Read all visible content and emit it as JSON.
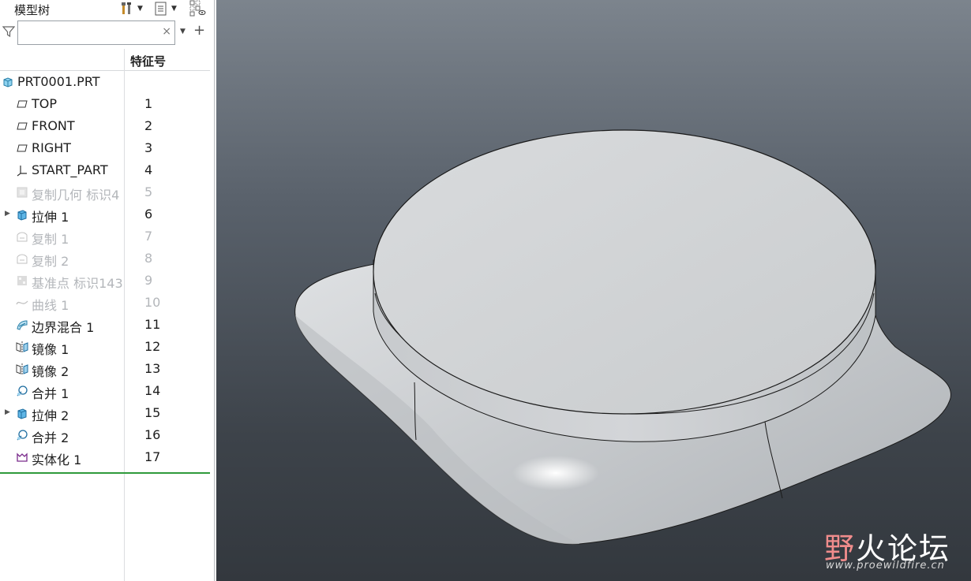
{
  "panel": {
    "title": "模型树",
    "search": {
      "value": "",
      "placeholder": ""
    },
    "clear_symbol": "×",
    "add_symbol": "+",
    "column_header": "特征号"
  },
  "tree": [
    {
      "label": "PRT0001.PRT",
      "num": "",
      "icon": "part-icon",
      "state": "normal",
      "expandable": false,
      "indent": 0
    },
    {
      "label": "TOP",
      "num": "1",
      "icon": "datum-plane-icon",
      "state": "normal",
      "expandable": false,
      "indent": 1
    },
    {
      "label": "FRONT",
      "num": "2",
      "icon": "datum-plane-icon",
      "state": "normal",
      "expandable": false,
      "indent": 1
    },
    {
      "label": "RIGHT",
      "num": "3",
      "icon": "datum-plane-icon",
      "state": "normal",
      "expandable": false,
      "indent": 1
    },
    {
      "label": "START_PART",
      "num": "4",
      "icon": "coordinate-system-icon",
      "state": "normal",
      "expandable": false,
      "indent": 1
    },
    {
      "label": "复制几何 标识4",
      "num": "5",
      "icon": "copy-geometry-icon",
      "state": "suppressed",
      "expandable": false,
      "indent": 1
    },
    {
      "label": "拉伸 1",
      "num": "6",
      "icon": "extrude-icon",
      "state": "normal",
      "expandable": true,
      "indent": 1
    },
    {
      "label": "复制 1",
      "num": "7",
      "icon": "copy-surface-icon",
      "state": "suppressed",
      "expandable": false,
      "indent": 1
    },
    {
      "label": "复制 2",
      "num": "8",
      "icon": "copy-surface-icon",
      "state": "suppressed",
      "expandable": false,
      "indent": 1
    },
    {
      "label": "基准点 标识143",
      "num": "9",
      "icon": "datum-point-icon",
      "state": "suppressed",
      "expandable": false,
      "indent": 1
    },
    {
      "label": "曲线 1",
      "num": "10",
      "icon": "curve-icon",
      "state": "suppressed",
      "expandable": false,
      "indent": 1
    },
    {
      "label": "边界混合 1",
      "num": "11",
      "icon": "boundary-blend-icon",
      "state": "normal",
      "expandable": false,
      "indent": 1
    },
    {
      "label": "镜像 1",
      "num": "12",
      "icon": "mirror-icon",
      "state": "normal",
      "expandable": false,
      "indent": 1
    },
    {
      "label": "镜像 2",
      "num": "13",
      "icon": "mirror-icon",
      "state": "normal",
      "expandable": false,
      "indent": 1
    },
    {
      "label": "合并 1",
      "num": "14",
      "icon": "merge-icon",
      "state": "normal",
      "expandable": false,
      "indent": 1
    },
    {
      "label": "拉伸 2",
      "num": "15",
      "icon": "extrude-icon",
      "state": "normal",
      "expandable": true,
      "indent": 1
    },
    {
      "label": "合并 2",
      "num": "16",
      "icon": "merge-icon",
      "state": "normal",
      "expandable": false,
      "indent": 1
    },
    {
      "label": "实体化 1",
      "num": "17",
      "icon": "solidify-icon",
      "state": "normal",
      "expandable": false,
      "indent": 1
    }
  ],
  "watermark": {
    "title_part1": "野",
    "title_part2": "火论坛",
    "url": "www.proewildfire.cn"
  },
  "colors": {
    "insert_line": "#2f9a3b",
    "suppressed_text": "#b3b6ba",
    "viewport_top": "#7c848d",
    "viewport_bottom": "#33383e"
  }
}
